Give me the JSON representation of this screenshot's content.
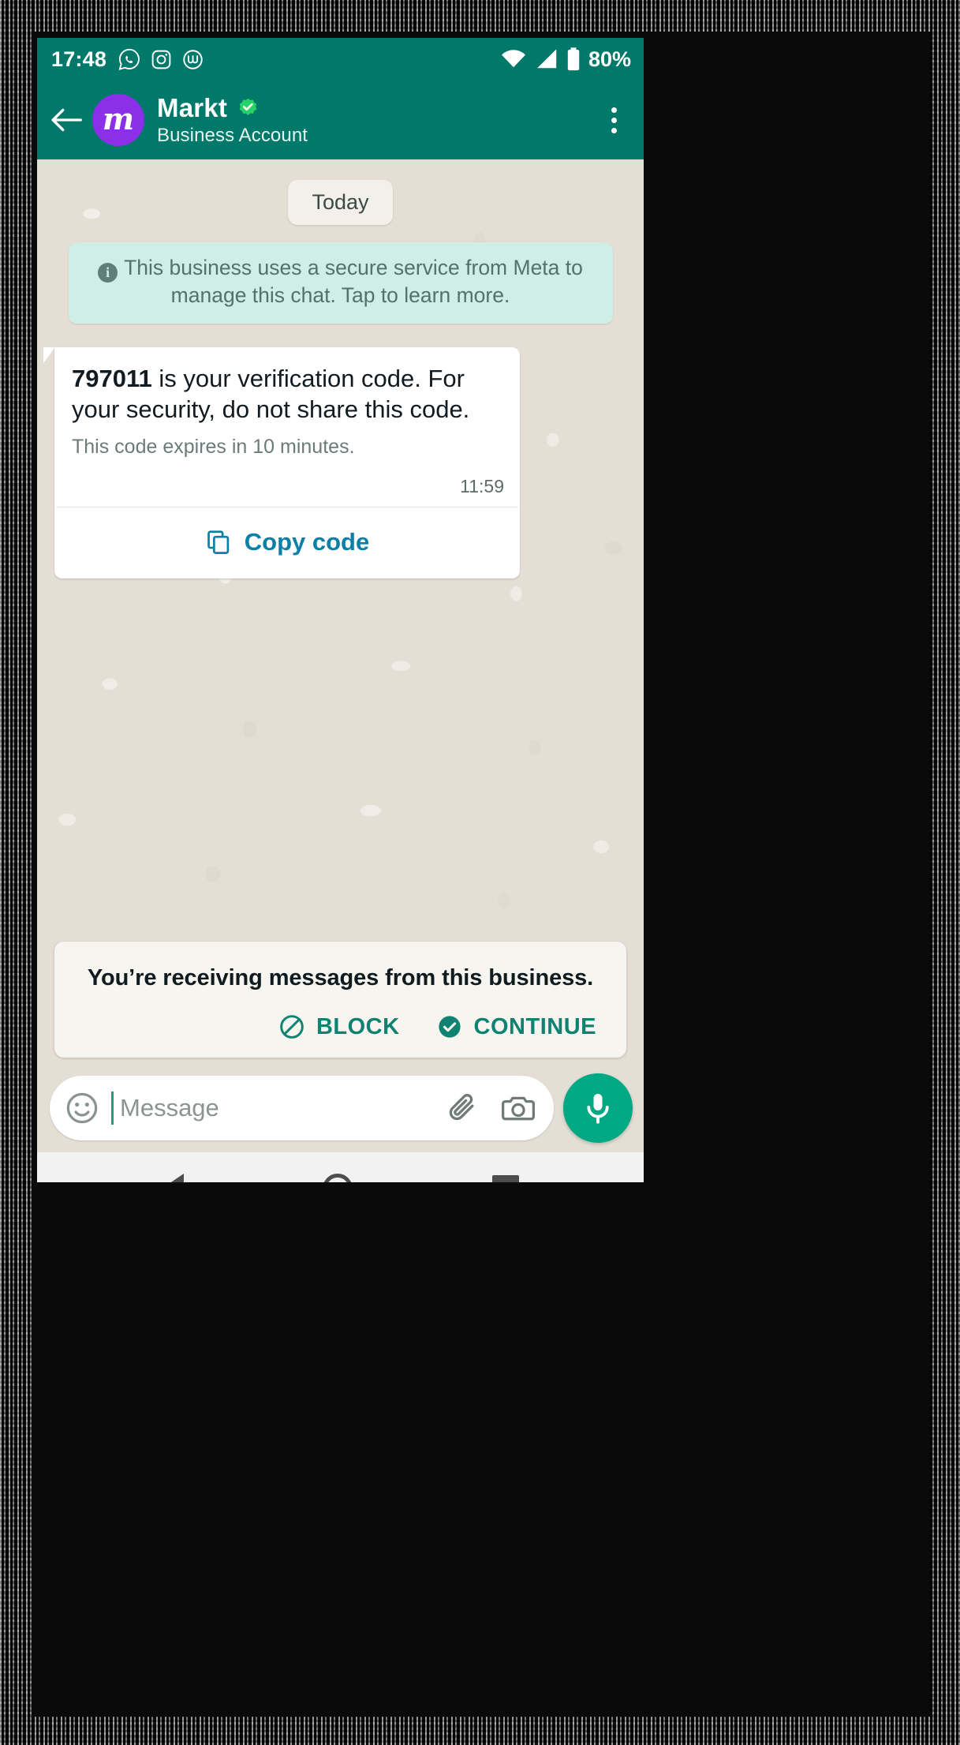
{
  "status_bar": {
    "time": "17:48",
    "battery_percent": "80%",
    "icons": [
      "whatsapp-icon",
      "instagram-icon",
      "workplace-icon",
      "wifi-icon",
      "cellular-signal-icon",
      "battery-icon"
    ]
  },
  "chat_header": {
    "back_label": "back-arrow",
    "avatar_letter": "m",
    "contact_name": "Markt",
    "verified": true,
    "subtitle": "Business Account",
    "menu_label": "overflow-menu"
  },
  "chat": {
    "date_divider": "Today",
    "info_banner": "This business uses a secure service from Meta to manage this chat. Tap to learn more.",
    "message": {
      "code": "797011",
      "body_rest": " is your verification code. For your security, do not share this code.",
      "expiry_note": "This code expires in 10 minutes.",
      "time": "11:59",
      "copy_button": "Copy code"
    }
  },
  "business_prompt": {
    "text": "You’re receiving messages from this business.",
    "block_label": "BLOCK",
    "continue_label": "CONTINUE"
  },
  "input_bar": {
    "placeholder": "Message",
    "emoji_icon": "emoji-smiley-icon",
    "attach_icon": "paperclip-icon",
    "camera_icon": "camera-icon",
    "mic_icon": "microphone-icon"
  },
  "nav_bar": {
    "back": "nav-back-triangle",
    "home": "nav-home-circle",
    "recents": "nav-recents-square"
  },
  "colors": {
    "header_green": "#00796B",
    "accent_teal": "#0f8271",
    "link_blue": "#0a7fa8",
    "avatar_purple": "#8B2FE8",
    "verified_green": "#25D366",
    "mic_green": "#00a884",
    "chat_bg": "#e4ded5",
    "info_banner_bg": "#cfeee6"
  }
}
